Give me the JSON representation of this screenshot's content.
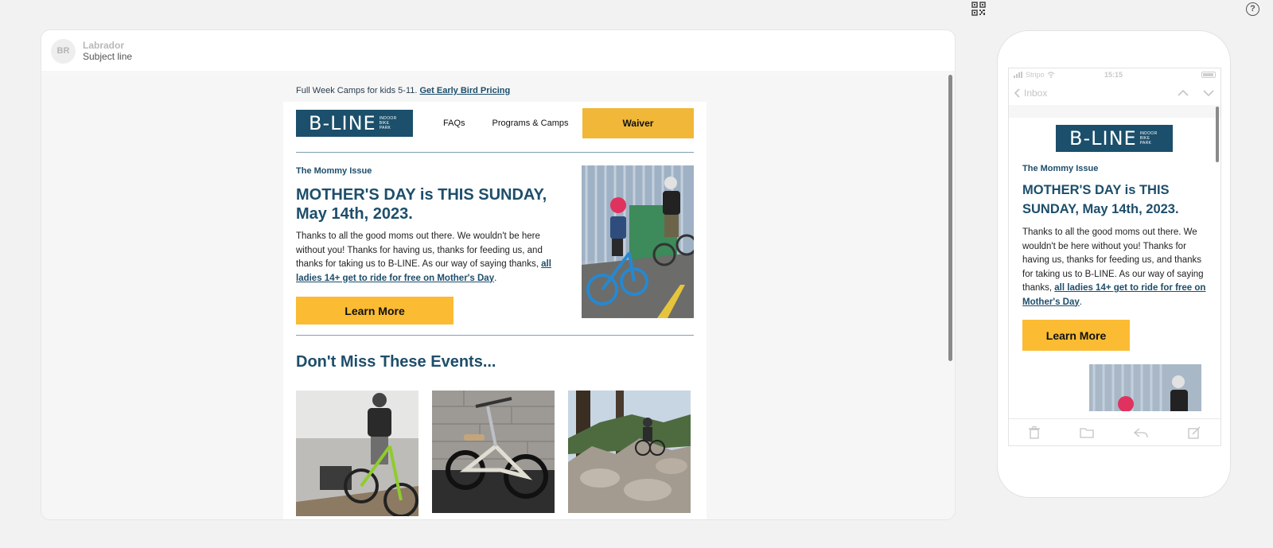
{
  "toolbar": {
    "qr_icon": "qr-code-icon",
    "help_icon": "help-icon",
    "help_glyph": "?"
  },
  "desktop": {
    "avatar_initials": "BR",
    "sender_name": "Labrador",
    "subject": "Subject line"
  },
  "email": {
    "preheader_text": "Full Week Camps for kids 5-11.",
    "preheader_link": "Get Early Bird Pricing",
    "logo_main": "B-LINE",
    "logo_sub_1": "INDOOR",
    "logo_sub_2": "BIKE",
    "logo_sub_3": "PARK",
    "nav_faqs": "FAQs",
    "nav_programs": "Programs & Camps",
    "nav_waiver": "Waiver",
    "eyebrow": "The Mommy Issue",
    "headline": "MOTHER'S DAY is THIS SUNDAY, May 14th, 2023.",
    "body": "Thanks to all the good moms out there. We wouldn't be here without you! Thanks for having us, thanks for feeding us, and thanks for taking us to B-LINE. As our way of saying thanks,",
    "body_link": "all ladies 14+ get to ride for free on Mother's Day",
    "body_end": ".",
    "learn_more": "Learn More",
    "events_title": "Don't Miss These Events..."
  },
  "phone": {
    "carrier": "Stripo",
    "time": "15:15",
    "inbox_label": "Inbox"
  },
  "colors": {
    "brand_blue": "#1b4f6b",
    "accent_yellow": "#fbbb33"
  }
}
